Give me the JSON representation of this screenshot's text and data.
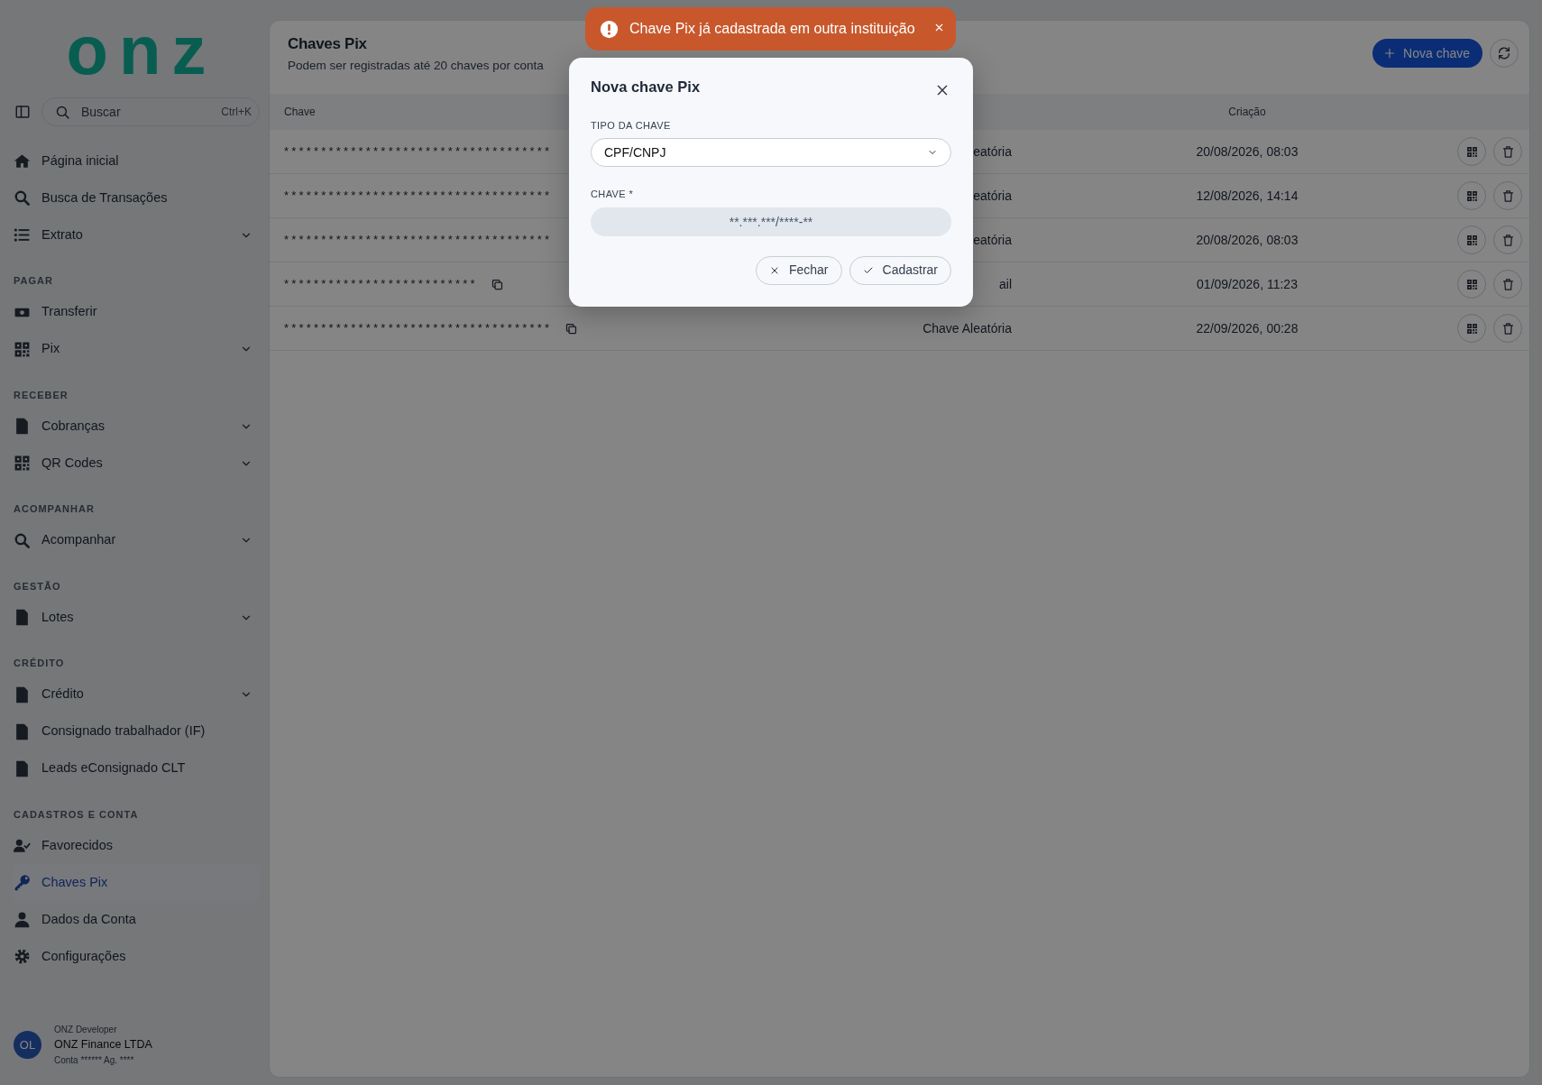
{
  "sidebar": {
    "logo": "onz",
    "search": {
      "placeholder": "Buscar",
      "shortcut": "Ctrl+K"
    },
    "sections": [
      {
        "items": [
          {
            "label": "Página inicial",
            "selected": false
          },
          {
            "label": "Busca de Transações",
            "selected": false
          },
          {
            "label": "Extrato",
            "selected": false,
            "expanded": false
          }
        ]
      },
      {
        "title": "PAGAR",
        "items": [
          {
            "label": "Transferir",
            "selected": false
          },
          {
            "label": "Pix",
            "selected": false,
            "expanded": false
          }
        ]
      },
      {
        "title": "RECEBER",
        "items": [
          {
            "label": "Cobranças",
            "selected": false,
            "expanded": false
          },
          {
            "label": "QR Codes",
            "selected": false,
            "expanded": false
          }
        ]
      },
      {
        "title": "ACOMPANHAR",
        "items": [
          {
            "label": "Acompanhar",
            "selected": false,
            "expanded": false
          }
        ]
      },
      {
        "title": "GESTÃO",
        "items": [
          {
            "label": "Lotes",
            "selected": false,
            "expanded": false
          }
        ]
      },
      {
        "title": "CRÉDITO",
        "items": [
          {
            "label": "Crédito",
            "selected": false,
            "expanded": false
          },
          {
            "label": "Consignado trabalhador (IF)",
            "selected": false
          },
          {
            "label": "Leads eConsignado CLT",
            "selected": false
          }
        ]
      },
      {
        "title": "CADASTROS E CONTA",
        "items": [
          {
            "label": "Favorecidos",
            "selected": false
          },
          {
            "label": "Chaves Pix",
            "selected": true
          },
          {
            "label": "Dados da Conta",
            "selected": false
          },
          {
            "label": "Configurações",
            "selected": false
          }
        ]
      }
    ],
    "user": {
      "initials": "OL",
      "role": "ONZ Developer",
      "company": "ONZ Finance LTDA",
      "account": "Conta ****** Ag. ****"
    }
  },
  "page": {
    "title": "Chaves Pix",
    "subtitle": "Podem ser registradas até 20 chaves por conta",
    "new_button": "Nova chave"
  },
  "table": {
    "columns": [
      "Chave",
      "Criação"
    ],
    "rows": [
      {
        "key": "************************************",
        "type": "eatória",
        "created": "20/08/2026, 08:03"
      },
      {
        "key": "************************************",
        "type": "eatória",
        "created": "12/08/2026, 14:14"
      },
      {
        "key": "************************************",
        "type": "eatória",
        "created": "20/08/2026, 08:03"
      },
      {
        "key": "**************************",
        "type": "ail",
        "created": "01/09/2026, 11:23"
      },
      {
        "key": "************************************",
        "type": "Chave Aleatória",
        "created": "22/09/2026, 00:28"
      }
    ]
  },
  "modal": {
    "title": "Nova chave Pix",
    "type_label": "TIPO DA CHAVE",
    "type_value": "CPF/CNPJ",
    "key_label": "CHAVE *",
    "key_placeholder": "**.***.***/****-**",
    "buttons": [
      {
        "label": "Fechar",
        "kind": "close"
      },
      {
        "label": "Cadastrar",
        "kind": "confirm"
      }
    ]
  },
  "toast": {
    "message": "Chave Pix já cadastrada em outra instituição"
  }
}
